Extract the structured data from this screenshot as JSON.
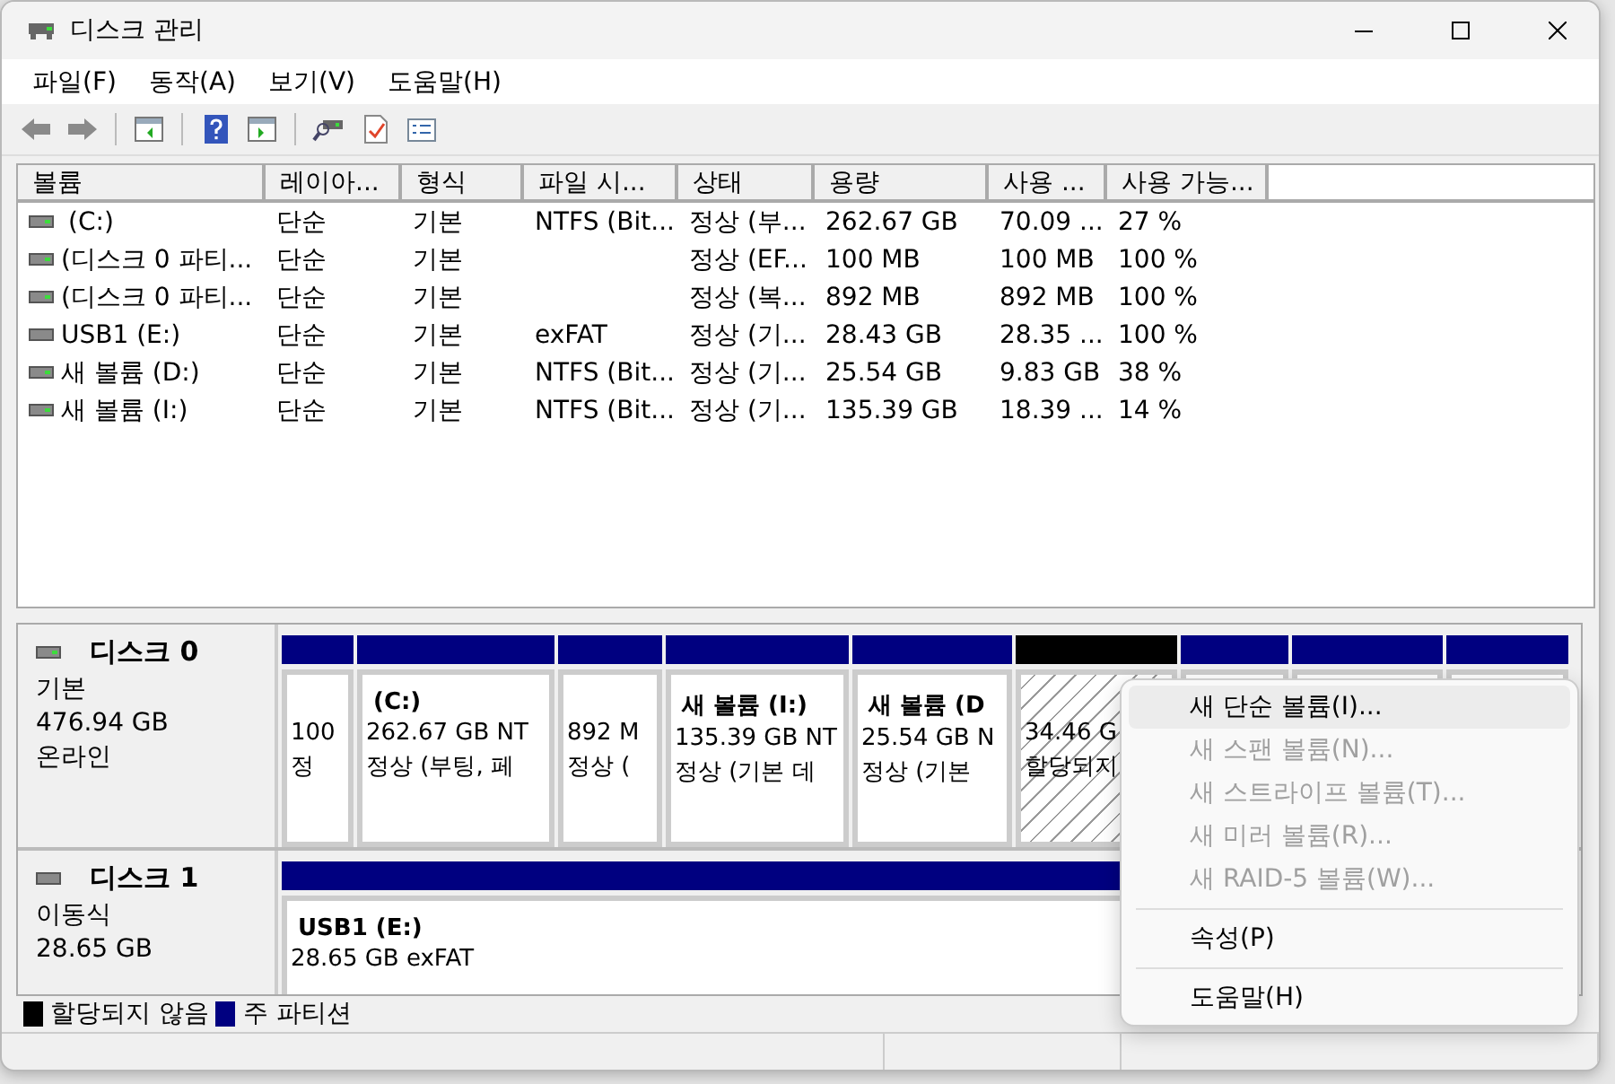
{
  "window": {
    "title": "디스크 관리"
  },
  "menu": [
    "파일(F)",
    "동작(A)",
    "보기(V)",
    "도움말(H)"
  ],
  "volume_table": {
    "columns": [
      "볼륨",
      "레이아...",
      "형식",
      "파일 시...",
      "상태",
      "용량",
      "사용 ...",
      "사용 가능..."
    ],
    "rows": [
      {
        "kind": "fixed",
        "cells": [
          "(C:)",
          "단순",
          "기본",
          "NTFS (Bit...",
          "정상 (부...",
          "262.67 GB",
          "70.09 ...",
          "27 %"
        ]
      },
      {
        "kind": "fixed",
        "cells": [
          "(디스크 0 파티...",
          "단순",
          "기본",
          "",
          "정상 (EF...",
          "100 MB",
          "100 MB",
          "100 %"
        ]
      },
      {
        "kind": "fixed",
        "cells": [
          "(디스크 0 파티...",
          "단순",
          "기본",
          "",
          "정상 (복...",
          "892 MB",
          "892 MB",
          "100 %"
        ]
      },
      {
        "kind": "removable",
        "cells": [
          "USB1 (E:)",
          "단순",
          "기본",
          "exFAT",
          "정상 (기...",
          "28.43 GB",
          "28.35 ...",
          "100 %"
        ]
      },
      {
        "kind": "fixed",
        "cells": [
          "새 볼륨 (D:)",
          "단순",
          "기본",
          "NTFS (Bit...",
          "정상 (기...",
          "25.54 GB",
          "9.83 GB",
          "38 %"
        ]
      },
      {
        "kind": "fixed",
        "cells": [
          "새 볼륨 (I:)",
          "단순",
          "기본",
          "NTFS (Bit...",
          "정상 (기...",
          "135.39 GB",
          "18.39 ...",
          "14 %"
        ]
      }
    ]
  },
  "disks": [
    {
      "kind": "fixed",
      "name": "디스크 0",
      "type": "기본",
      "size": "476.94 GB",
      "status": "온라인",
      "partitions": [
        {
          "kind": "primary",
          "lines": [
            "100",
            "정"
          ]
        },
        {
          "kind": "primary",
          "title": "(C:)",
          "lines": [
            "262.67 GB NT",
            "정상 (부팅, 페"
          ]
        },
        {
          "kind": "primary",
          "lines": [
            "892 M",
            "정상 ("
          ]
        },
        {
          "kind": "primary",
          "title": "새 볼륨  (I:)",
          "lines": [
            "135.39 GB NT",
            "정상 (기본 데"
          ]
        },
        {
          "kind": "primary",
          "title": "새 볼륨  (D",
          "lines": [
            "25.54 GB N",
            "정상 (기본"
          ]
        },
        {
          "kind": "unallocated",
          "lines": [
            "34.46 G",
            "할당되지"
          ]
        },
        {
          "kind": "primary"
        },
        {
          "kind": "primary"
        },
        {
          "kind": "primary"
        }
      ]
    },
    {
      "kind": "removable",
      "name": "디스크 1",
      "type": "이동식",
      "size": "28.65 GB",
      "partitions": [
        {
          "kind": "primary",
          "title": "USB1  (E:)",
          "lines": [
            "28.65 GB exFAT"
          ]
        }
      ]
    }
  ],
  "legend": [
    {
      "label": "할당되지 않음",
      "color": "#000000"
    },
    {
      "label": "주 파티션",
      "color": "#000080"
    }
  ],
  "context_menu": [
    {
      "kind": "item",
      "label": "새 단순 볼륨(I)...",
      "disabled": false,
      "selected": true
    },
    {
      "kind": "item",
      "label": "새 스팬 볼륨(N)...",
      "disabled": true,
      "selected": false
    },
    {
      "kind": "item",
      "label": "새 스트라이프 볼륨(T)...",
      "disabled": true,
      "selected": false
    },
    {
      "kind": "item",
      "label": "새 미러 볼륨(R)...",
      "disabled": true,
      "selected": false
    },
    {
      "kind": "item",
      "label": "새 RAID-5 볼륨(W)...",
      "disabled": true,
      "selected": false
    },
    {
      "kind": "separator"
    },
    {
      "kind": "item",
      "label": "속성(P)",
      "disabled": false,
      "selected": false
    },
    {
      "kind": "separator"
    },
    {
      "kind": "item",
      "label": "도움말(H)",
      "disabled": false,
      "selected": false
    }
  ]
}
